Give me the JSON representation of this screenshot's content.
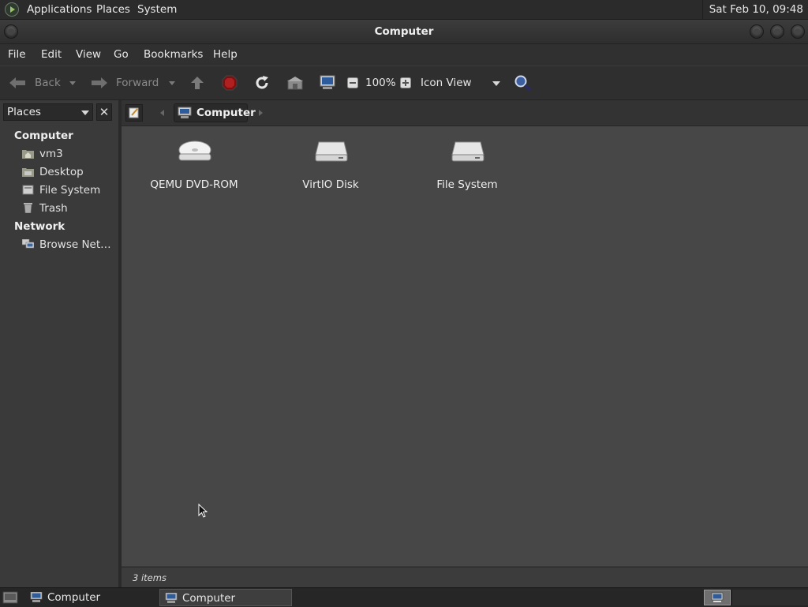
{
  "top_panel": {
    "menus": [
      "Applications",
      "Places",
      "System"
    ],
    "clock": "Sat Feb 10, 09:48"
  },
  "window": {
    "title": "Computer",
    "menu": [
      "File",
      "Edit",
      "View",
      "Go",
      "Bookmarks",
      "Help"
    ]
  },
  "toolbar": {
    "back": "Back",
    "forward": "Forward",
    "zoom": "100%",
    "view_mode": "Icon View"
  },
  "sidebar": {
    "selector": "Places",
    "sections": [
      {
        "title": "Computer",
        "items": [
          {
            "label": "vm3",
            "icon": "home-folder-icon"
          },
          {
            "label": "Desktop",
            "icon": "desktop-folder-icon"
          },
          {
            "label": "File System",
            "icon": "filesystem-icon"
          },
          {
            "label": "Trash",
            "icon": "trash-icon"
          }
        ]
      },
      {
        "title": "Network",
        "items": [
          {
            "label": "Browse Net…",
            "icon": "network-icon"
          }
        ]
      }
    ]
  },
  "location": {
    "crumb": "Computer"
  },
  "files": [
    {
      "label": "QEMU DVD-ROM",
      "icon": "optical-drive-icon"
    },
    {
      "label": "VirtIO Disk",
      "icon": "hard-disk-icon"
    },
    {
      "label": "File System",
      "icon": "hard-disk-icon"
    }
  ],
  "status": {
    "text": "3 items"
  },
  "taskbar": {
    "tasks": [
      "Computer",
      "Computer"
    ]
  }
}
